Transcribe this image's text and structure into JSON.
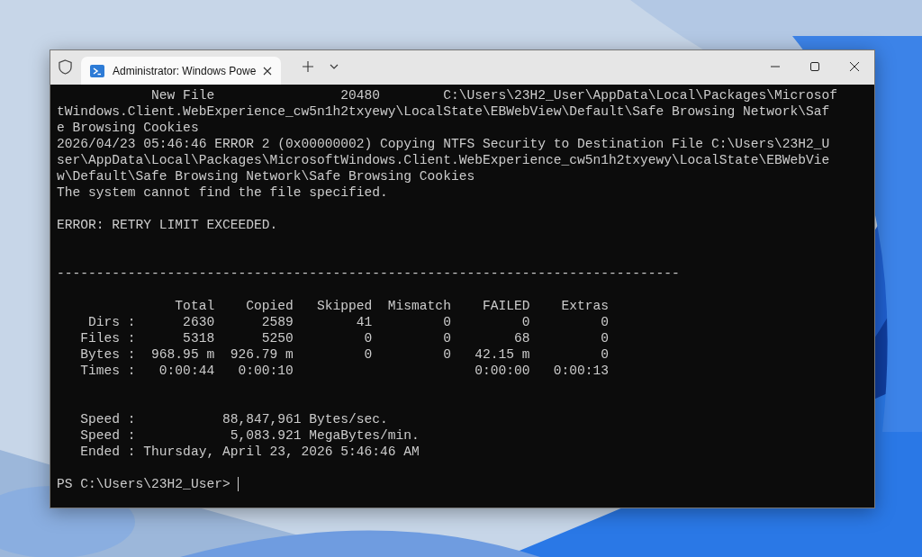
{
  "window": {
    "tab": {
      "title": "Administrator: Windows Powe",
      "selected": true
    }
  },
  "terminal": {
    "lines": [
      {
        "kind": "text",
        "text": "            New File                20480        C:\\Users\\23H2_User\\AppData\\Local\\Packages\\Microsof"
      },
      {
        "kind": "text",
        "text": "tWindows.Client.WebExperience_cw5n1h2txyewy\\LocalState\\EBWebView\\Default\\Safe Browsing Network\\Saf"
      },
      {
        "kind": "text",
        "text": "e Browsing Cookies"
      },
      {
        "kind": "text",
        "text": "2026/04/23 05:46:46 ERROR 2 (0x00000002) Copying NTFS Security to Destination File C:\\Users\\23H2_U"
      },
      {
        "kind": "text",
        "text": "ser\\AppData\\Local\\Packages\\MicrosoftWindows.Client.WebExperience_cw5n1h2txyewy\\LocalState\\EBWebVie"
      },
      {
        "kind": "text",
        "text": "w\\Default\\Safe Browsing Network\\Safe Browsing Cookies"
      },
      {
        "kind": "text",
        "text": "The system cannot find the file specified."
      },
      {
        "kind": "blank"
      },
      {
        "kind": "text",
        "text": "ERROR: RETRY LIMIT EXCEEDED."
      },
      {
        "kind": "blank"
      },
      {
        "kind": "blank"
      },
      {
        "kind": "text",
        "text": "-------------------------------------------------------------------------------"
      },
      {
        "kind": "blank"
      },
      {
        "kind": "text",
        "text": "               Total    Copied   Skipped  Mismatch    FAILED    Extras"
      },
      {
        "kind": "text",
        "text": "    Dirs :      2630      2589        41         0         0         0"
      },
      {
        "kind": "text",
        "text": "   Files :      5318      5250         0         0        68         0"
      },
      {
        "kind": "text",
        "text": "   Bytes :  968.95 m  926.79 m         0         0   42.15 m         0"
      },
      {
        "kind": "text",
        "text": "   Times :   0:00:44   0:00:10                       0:00:00   0:00:13"
      },
      {
        "kind": "blank"
      },
      {
        "kind": "blank"
      },
      {
        "kind": "text",
        "text": "   Speed :           88,847,961 Bytes/sec."
      },
      {
        "kind": "text",
        "text": "   Speed :            5,083.921 MegaBytes/min."
      },
      {
        "kind": "text",
        "text": "   Ended : Thursday, April 23, 2026 5:46:46 AM"
      },
      {
        "kind": "blank"
      },
      {
        "kind": "prompt",
        "text": "PS C:\\Users\\23H2_User> ",
        "cursor": true
      }
    ]
  }
}
